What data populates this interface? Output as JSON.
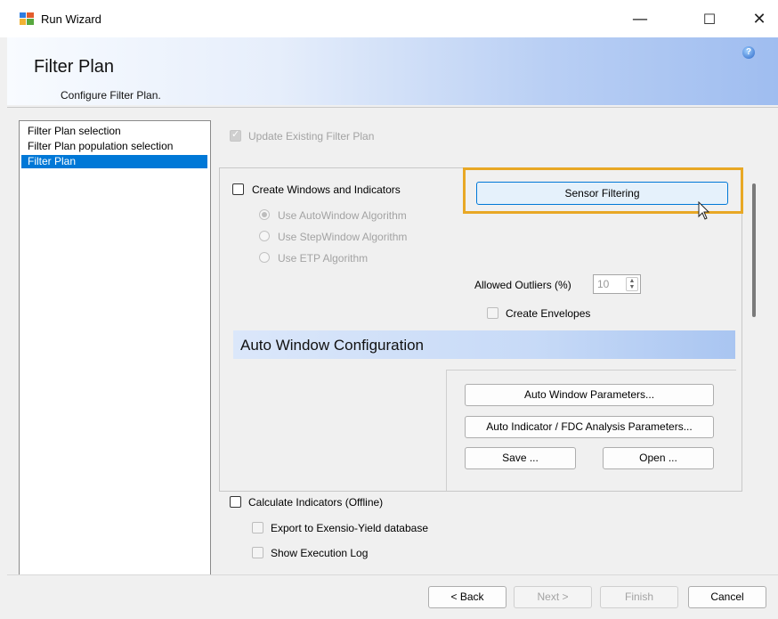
{
  "window": {
    "title": "Run Wizard",
    "minimize": "—",
    "maximize": "☐",
    "close": "✕"
  },
  "header": {
    "title": "Filter Plan",
    "subtitle": "Configure Filter Plan.",
    "help": "?"
  },
  "nav": {
    "items": [
      {
        "label": "Filter Plan selection",
        "selected": false
      },
      {
        "label": "Filter Plan population selection",
        "selected": false
      },
      {
        "label": "Filter Plan",
        "selected": true
      }
    ]
  },
  "main": {
    "update_existing": {
      "label": "Update Existing Filter Plan",
      "checked": true,
      "disabled": true
    },
    "create_windows": {
      "label": "Create Windows and Indicators",
      "checked": false
    },
    "algorithms": [
      {
        "label": "Use AutoWindow Algorithm",
        "selected": true
      },
      {
        "label": "Use StepWindow Algorithm",
        "selected": false
      },
      {
        "label": "Use ETP Algorithm",
        "selected": false
      }
    ],
    "sensor_filtering_label": "Sensor Filtering",
    "allowed_outliers": {
      "label": "Allowed Outliers (%)",
      "value": "10"
    },
    "create_envelopes": {
      "label": "Create Envelopes",
      "checked": false
    },
    "auto_window_section": "Auto Window Configuration",
    "auto_window_params_label": "Auto Window Parameters...",
    "auto_indicator_params_label": "Auto Indicator / FDC Analysis Parameters...",
    "save_label": "Save ...",
    "open_label": "Open ...",
    "calculate_indicators": {
      "label": "Calculate Indicators (Offline)",
      "checked": false
    },
    "export_yield": {
      "label": "Export to Exensio-Yield database",
      "checked": false
    },
    "show_log": {
      "label": "Show Execution Log",
      "checked": false
    }
  },
  "footer": {
    "back": "< Back",
    "next": "Next >",
    "finish": "Finish",
    "cancel": "Cancel"
  },
  "colors": {
    "highlight": "#e8a825",
    "selection": "#0078d7"
  }
}
